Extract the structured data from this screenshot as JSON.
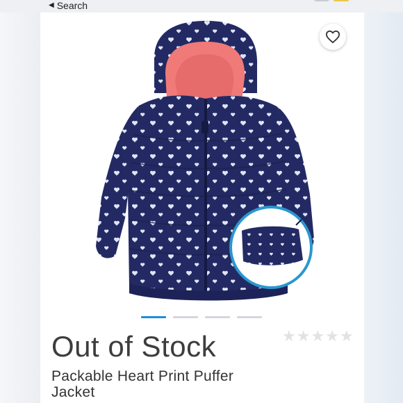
{
  "nav": {
    "back_label": "Search"
  },
  "product": {
    "stock_status": "Out of Stock",
    "name": "Packable Heart Print Puffer Jacket",
    "rating_stars": 5,
    "image_count": 4,
    "active_image_index": 0
  },
  "icons": {
    "back": "back-triangle-icon",
    "favorite": "heart-outline-icon",
    "rating": "star-icon"
  },
  "colors": {
    "jacket_navy": "#232a63",
    "hood_lining": "#f07a78",
    "accent_blue": "#1f8fd6",
    "pouch_ring": "#2a97cf"
  }
}
